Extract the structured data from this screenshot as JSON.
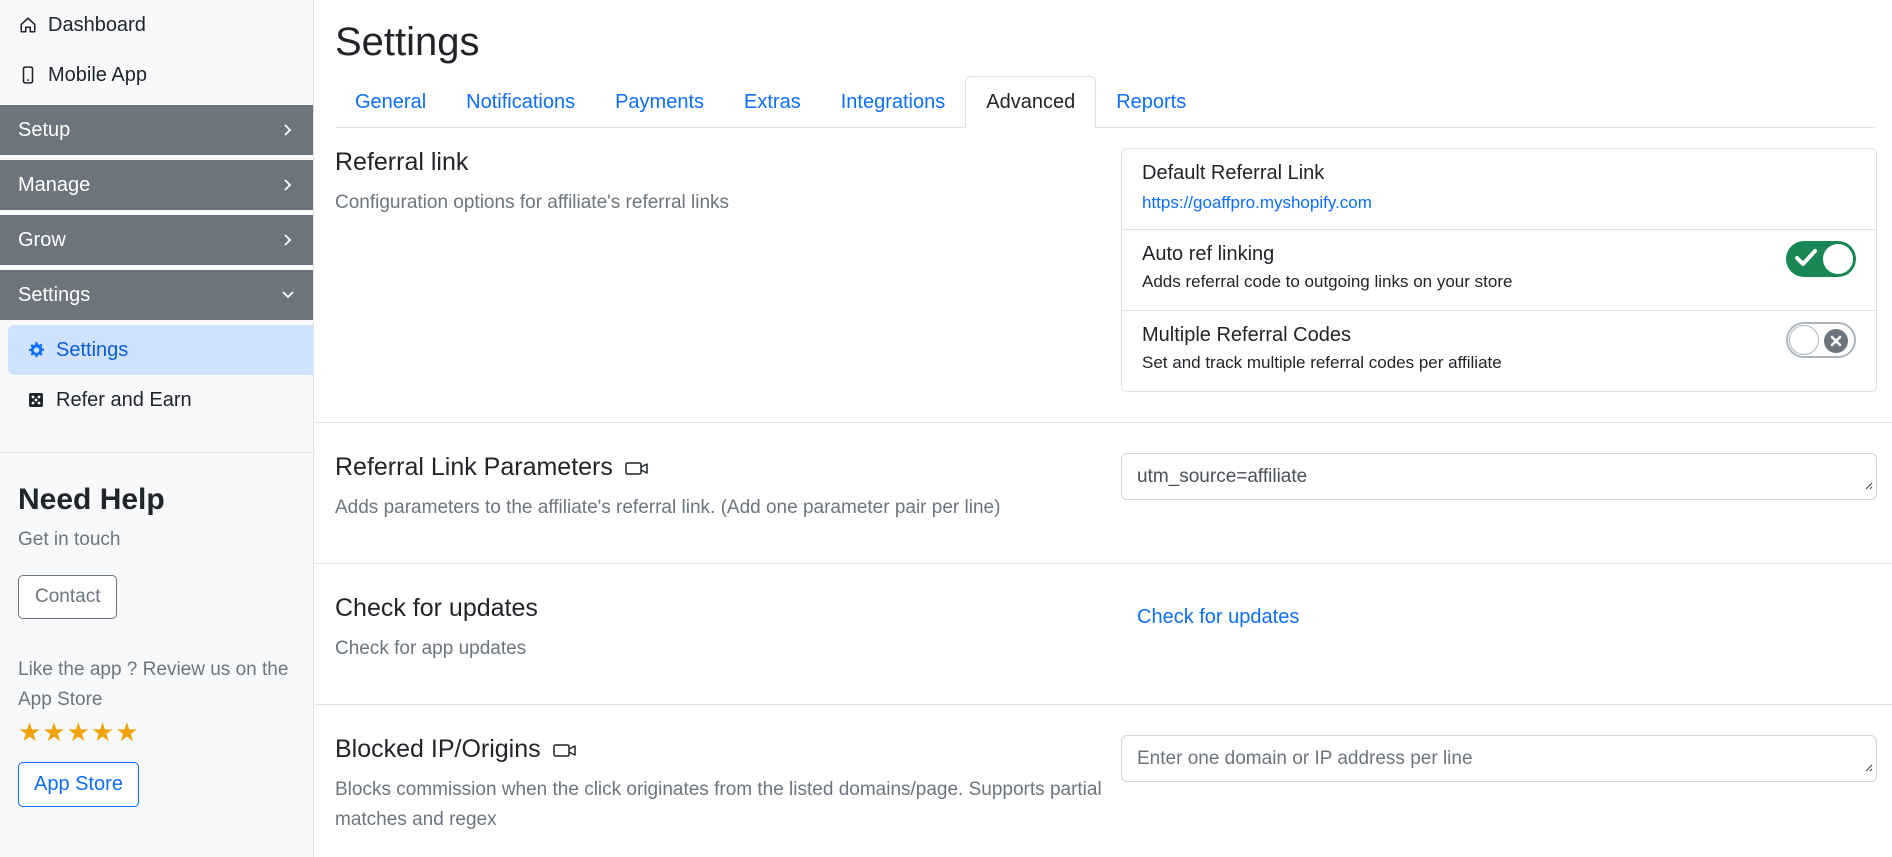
{
  "sidebar": {
    "dashboard": "Dashboard",
    "mobile_app": "Mobile App",
    "groups": [
      "Setup",
      "Manage",
      "Grow",
      "Settings"
    ],
    "sub_items": [
      "Settings",
      "Refer and Earn"
    ]
  },
  "help": {
    "title": "Need Help",
    "subtitle": "Get in touch",
    "contact_label": "Contact",
    "review_text": "Like the app ? Review us on the App Store",
    "stars": "★★★★★",
    "app_store_label": "App Store"
  },
  "page": {
    "title": "Settings",
    "tabs": [
      "General",
      "Notifications",
      "Payments",
      "Extras",
      "Integrations",
      "Advanced",
      "Reports"
    ],
    "active_tab": "Advanced"
  },
  "referral_link": {
    "title": "Referral link",
    "description": "Configuration options for affiliate's referral links",
    "default_label": "Default Referral Link",
    "default_url": "https://goaffpro.myshopify.com",
    "auto_ref_label": "Auto ref linking",
    "auto_ref_desc": "Adds referral code to outgoing links on your store",
    "auto_ref_enabled": true,
    "multi_codes_label": "Multiple Referral Codes",
    "multi_codes_desc": "Set and track multiple referral codes per affiliate",
    "multi_codes_enabled": false
  },
  "link_params": {
    "title": "Referral Link Parameters",
    "description": "Adds parameters to the affiliate's referral link. (Add one parameter pair per line)",
    "value": "utm_source=affiliate"
  },
  "updates": {
    "title": "Check for updates",
    "description": "Check for app updates",
    "link": "Check for updates"
  },
  "blocked": {
    "title": "Blocked IP/Origins",
    "description": "Blocks commission when the click originates from the listed domains/page. Supports partial matches and regex",
    "placeholder": "Enter one domain or IP address per line"
  },
  "colors": {
    "primary": "#0d6efd",
    "sidebar_group": "#6c757d",
    "active_item_bg": "#cfe2ff",
    "toggle_on": "#198754",
    "stars": "#f0a30a"
  }
}
